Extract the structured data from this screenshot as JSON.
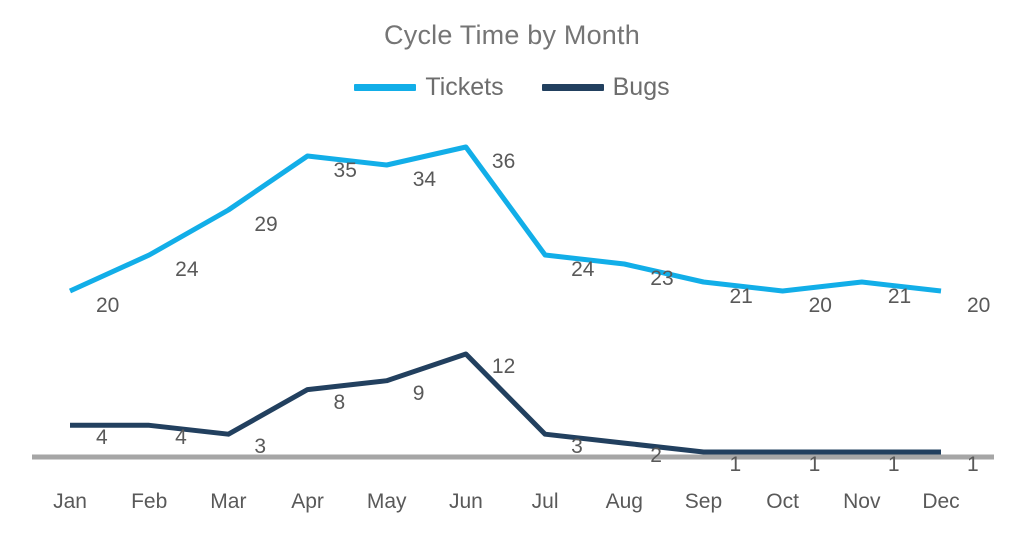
{
  "chart_data": {
    "type": "line",
    "title": "Cycle Time by Month",
    "xlabel": "",
    "ylabel": "",
    "grid": false,
    "legend_position": "top-center",
    "categories": [
      "Jan",
      "Feb",
      "Mar",
      "Apr",
      "May",
      "Jun",
      "Jul",
      "Aug",
      "Sep",
      "Oct",
      "Nov",
      "Dec"
    ],
    "ylim": [
      0,
      38
    ],
    "series": [
      {
        "name": "Tickets",
        "color": "#12AEE8",
        "values": [
          20,
          24,
          29,
          35,
          34,
          36,
          24,
          23,
          21,
          20,
          21,
          20
        ]
      },
      {
        "name": "Bugs",
        "color": "#22405F",
        "values": [
          4,
          4,
          3,
          8,
          9,
          12,
          3,
          2,
          1,
          1,
          1,
          1
        ]
      }
    ],
    "data_labels": {
      "Tickets": [
        "20",
        "24",
        "29",
        "35",
        "34",
        "36",
        "24",
        "23",
        "21",
        "20",
        "21",
        "20"
      ],
      "Bugs": [
        "4",
        "4",
        "3",
        "8",
        "9",
        "12",
        "3",
        "2",
        "1",
        "1",
        "1",
        "1"
      ]
    },
    "axis_color": "#A6A6A6",
    "label_color": "#595959",
    "title_color": "#757575"
  },
  "legend": {
    "items": [
      {
        "label": "Tickets",
        "color": "#12AEE8",
        "icon": "line-swatch-icon"
      },
      {
        "label": "Bugs",
        "color": "#22405F",
        "icon": "line-swatch-icon"
      }
    ]
  },
  "axis": {
    "ticks": [
      "Jan",
      "Feb",
      "Mar",
      "Apr",
      "May",
      "Jun",
      "Jul",
      "Aug",
      "Sep",
      "Oct",
      "Nov",
      "Dec"
    ]
  }
}
